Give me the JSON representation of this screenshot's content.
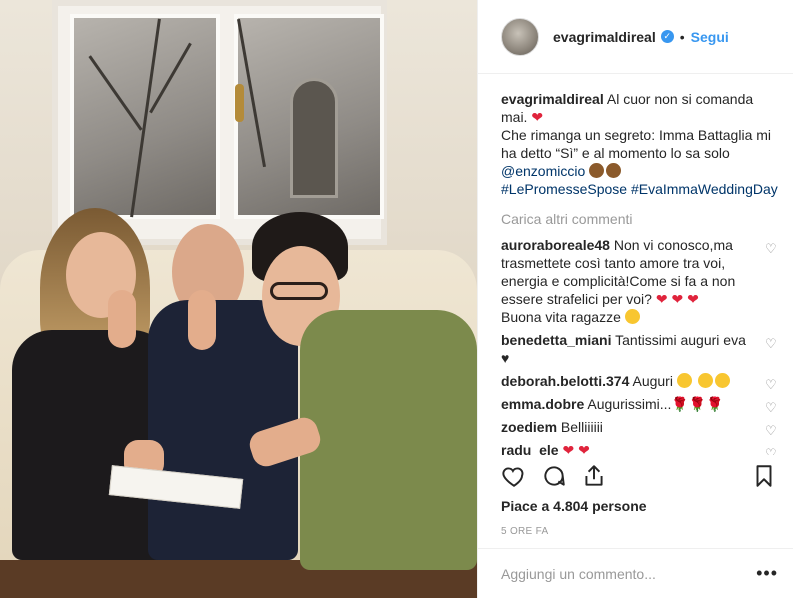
{
  "post": {
    "image_alt": "",
    "author": {
      "username": "evagrimaldireal",
      "verified_icon": "verified-badge-icon",
      "separator": "•",
      "follow_label": "Segui"
    },
    "caption": {
      "username": "evagrimaldireal",
      "line1": "Al cuor non si comanda mai.",
      "heart": "❤",
      "line2": "Che rimanga un segreto: Imma Battaglia mi ha detto “Sì” e al momento lo sa solo",
      "mention": "@enzomiccio",
      "hashtags": "#LePromesseSpose #EvaImmaWeddingDay"
    },
    "load_more_label": "Carica altri commenti",
    "comments": [
      {
        "username": "auroraboreale48",
        "text": "Non vi conosco,ma trasmettete così tanto amore tra voi, energia e complicità!Come si fa a non essere strafelici per voi?",
        "emoji": "❤ ❤ ❤",
        "text2": "Buona vita ragazze"
      },
      {
        "username": "benedetta_miani",
        "text": "Tantissimi auguri eva",
        "emoji": "♥"
      },
      {
        "username": "deborah.belotti.374",
        "text": "Auguri",
        "emoji": ""
      },
      {
        "username": "emma.dobre",
        "text": "Augurissimi...",
        "emoji": "🌹🌹🌹"
      },
      {
        "username": "zoediem",
        "text": "Belliiiiii",
        "emoji": ""
      },
      {
        "username": "radu_ele",
        "text": "",
        "emoji": "❤ ❤"
      }
    ],
    "likes_text": "Piace a 4.804 persone",
    "time_text": "5 ORE FA",
    "add_comment_placeholder": "Aggiungi un commento...",
    "more_label": "•••",
    "icons": {
      "like": "heart-outline-icon",
      "comment": "comment-bubble-icon",
      "share": "share-upload-icon",
      "save": "bookmark-icon"
    },
    "colors": {
      "link": "#3897f0",
      "tag": "#003569",
      "muted": "#999999",
      "heart_red": "#e0243c"
    }
  }
}
